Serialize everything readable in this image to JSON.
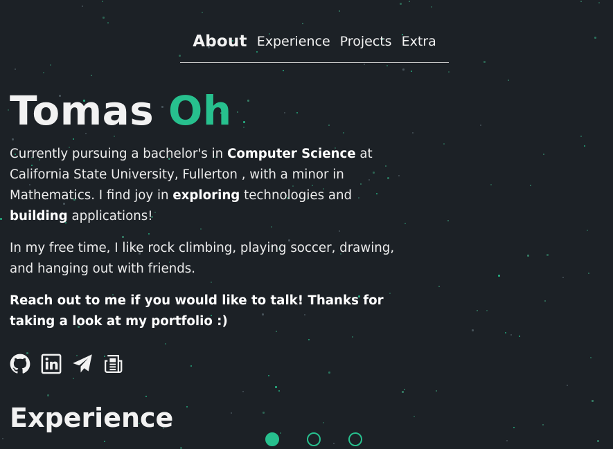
{
  "nav": {
    "items": [
      {
        "label": "About",
        "active": true
      },
      {
        "label": "Experience",
        "active": false
      },
      {
        "label": "Projects",
        "active": false
      },
      {
        "label": "Extra",
        "active": false
      }
    ]
  },
  "hero": {
    "first_name": "Tomas",
    "last_name": "Oh",
    "intro": {
      "t1": "Currently pursuing a bachelor's in ",
      "b1": "Computer Science",
      "t2": " at California State University, Fullerton , with a minor in Mathematics. I find joy in ",
      "b2": "exploring",
      "t3": " technologies and ",
      "b3": "building",
      "t4": " applications!"
    },
    "free_time": "In my free time, I like rock climbing, playing soccer, drawing, and hanging out with friends.",
    "cta": "Reach out to me if you would like to talk! Thanks for taking a look at my portfolio :)"
  },
  "socials": [
    {
      "icon": "github-icon"
    },
    {
      "icon": "linkedin-icon"
    },
    {
      "icon": "send-icon"
    },
    {
      "icon": "resume-icon"
    }
  ],
  "sections": {
    "experience_title": "Experience"
  },
  "pager": {
    "count": 3,
    "active_index": 0
  },
  "colors": {
    "background": "#1c2126",
    "accent": "#27c08e",
    "text": "#f2f2f2"
  }
}
